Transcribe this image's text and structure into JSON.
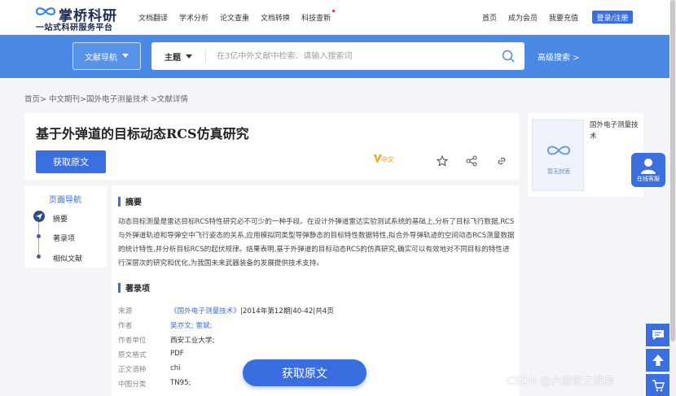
{
  "header": {
    "logo_title": "掌桥科研",
    "logo_sub": "一站式科研服务平台",
    "nav": [
      "文档翻译",
      "学术分析",
      "论文查重",
      "文档转换",
      "科技查新"
    ],
    "right_links": [
      "首页",
      "成为会员",
      "我要充值"
    ],
    "login": "登录/注册"
  },
  "search": {
    "nav_dropdown": "文献导航",
    "topic": "主题",
    "placeholder": "在3亿中外文献中检索、请输入搜索词",
    "advanced": "高级搜索 >"
  },
  "breadcrumb": "首页> 中文期刊>国外电子测量技术 >文献详情",
  "article": {
    "title": "基于外弹道的目标动态RCS仿真研究",
    "get_button": "获取原文",
    "lang_badge": "中文"
  },
  "cover": {
    "no_cover": "暂无封面",
    "journal": "国外电子测量技术"
  },
  "page_nav": {
    "title": "页面导航",
    "items": [
      "摘要",
      "著录项",
      "相似文献"
    ]
  },
  "abstract": {
    "title": "摘要",
    "text": "动态目标测量是雷达目标RCS特性研究必不可少的一种手段。在设计外弹道雷达实验测试系统的基础上,分析了目标飞行数据,RCS与外弹道轨迹和导弹空中飞行姿态的关系,应用模拟同类型导弹静态的目标特性数据特性,拟合外导弹轨迹的空间动态RCS测量数据的统计特性,并分析目标RCS的起伏规律。结果表明,基于外弹道的目标动态RCS的仿真研究,确实可以有效地对不同目标的特性进行深层次的研究和优化,为我国未来武器装备的发展提供技术支持。"
  },
  "record": {
    "title": "著录项",
    "rows": [
      {
        "k": "来源",
        "v_link": "《国外电子测量技术》",
        "v": "|2014年第12期|40-42|共4页"
      },
      {
        "k": "作者",
        "v_link": "吴亦文; 雷斌;",
        "v": ""
      },
      {
        "k": "作者单位",
        "v_link": "",
        "v": "西安工业大学;"
      },
      {
        "k": "原文格式",
        "v_link": "",
        "v": "PDF"
      },
      {
        "k": "正文语种",
        "v_link": "",
        "v": "chi"
      },
      {
        "k": "中图分类",
        "v_link": "",
        "v": "TN95;"
      }
    ]
  },
  "floating": {
    "get_button": "获取原文",
    "support": "在线客服"
  },
  "watermark": "CSDN @六维论文推荐",
  "colors": {
    "primary": "#3b6fe0",
    "band": "#4a8ae6"
  }
}
